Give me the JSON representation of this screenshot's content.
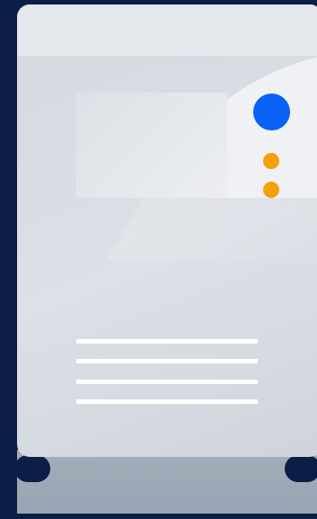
{
  "illustration": {
    "subject": "server",
    "vent_count": 4,
    "status_led_count": 2,
    "colors": {
      "background": "#0b1e45",
      "casing": "#d8dce3",
      "casing_top": "#e4e7eb",
      "base": "#a3acb9",
      "power_led": "#0a62f5",
      "status_led": "#f59f0a",
      "vents": "#ffffff"
    }
  }
}
